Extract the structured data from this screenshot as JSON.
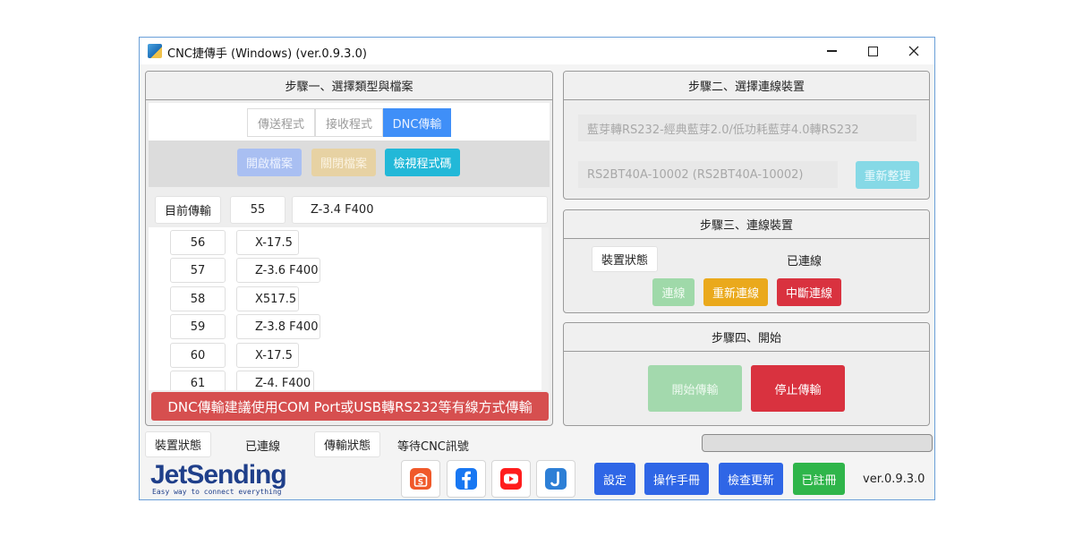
{
  "window": {
    "title": "CNC捷傳手 (Windows)  (ver.0.9.3.0)"
  },
  "step1": {
    "title": "步驟一、選擇類型與檔案",
    "tabs": [
      {
        "label": "傳送程式",
        "active": false
      },
      {
        "label": "接收程式",
        "active": false
      },
      {
        "label": "DNC傳輸",
        "active": true
      }
    ],
    "file_buttons": {
      "open": "開啟檔案",
      "close": "關閉檔案",
      "view": "檢視程式碼"
    },
    "current": {
      "label": "目前傳輸",
      "line": "55",
      "code": "Z-3.4 F400"
    },
    "rows": [
      {
        "num": "56",
        "code": "X-17.5"
      },
      {
        "num": "57",
        "code": "Z-3.6 F400"
      },
      {
        "num": "58",
        "code": "X517.5"
      },
      {
        "num": "59",
        "code": "Z-3.8 F400"
      },
      {
        "num": "60",
        "code": "X-17.5"
      },
      {
        "num": "61",
        "code": "Z-4. F400"
      }
    ],
    "warning": "DNC傳輸建議使用COM Port或USB轉RS232等有線方式傳輸"
  },
  "step2": {
    "title": "步驟二、選擇連線裝置",
    "device_type": "藍芽轉RS232-經典藍芽2.0/低功耗藍芽4.0轉RS232",
    "device": "RS2BT40A-10002 (RS2BT40A-10002)",
    "refresh": "重新整理"
  },
  "step3": {
    "title": "步驟三、連線裝置",
    "status_label": "裝置狀態",
    "status_value": "已連線",
    "connect": "連線",
    "reconnect": "重新連線",
    "disconnect": "中斷連線"
  },
  "step4": {
    "title": "步驟四、開始",
    "start": "開始傳輸",
    "stop": "停止傳輸"
  },
  "statusbar": {
    "device_label": "裝置狀態",
    "device_value": "已連線",
    "transfer_label": "傳輸狀態",
    "transfer_value": "等待CNC訊號",
    "progress": 0
  },
  "footer": {
    "logo": "JetSending",
    "logo_tagline": "Easy way to connect everything",
    "social": [
      "shopee-icon",
      "facebook-icon",
      "youtube-icon",
      "jetsending-icon"
    ],
    "settings": "設定",
    "manual": "操作手冊",
    "update": "檢查更新",
    "registered": "已註冊",
    "version": "ver.0.9.3.0"
  },
  "colors": {
    "blue": "#2f66e6",
    "tab_active": "#3f8ff8",
    "cyan": "#22b8d8",
    "green": "#2fb54a",
    "red": "#d9323f",
    "orange": "#eaa91c",
    "warning": "#d64f4f"
  }
}
